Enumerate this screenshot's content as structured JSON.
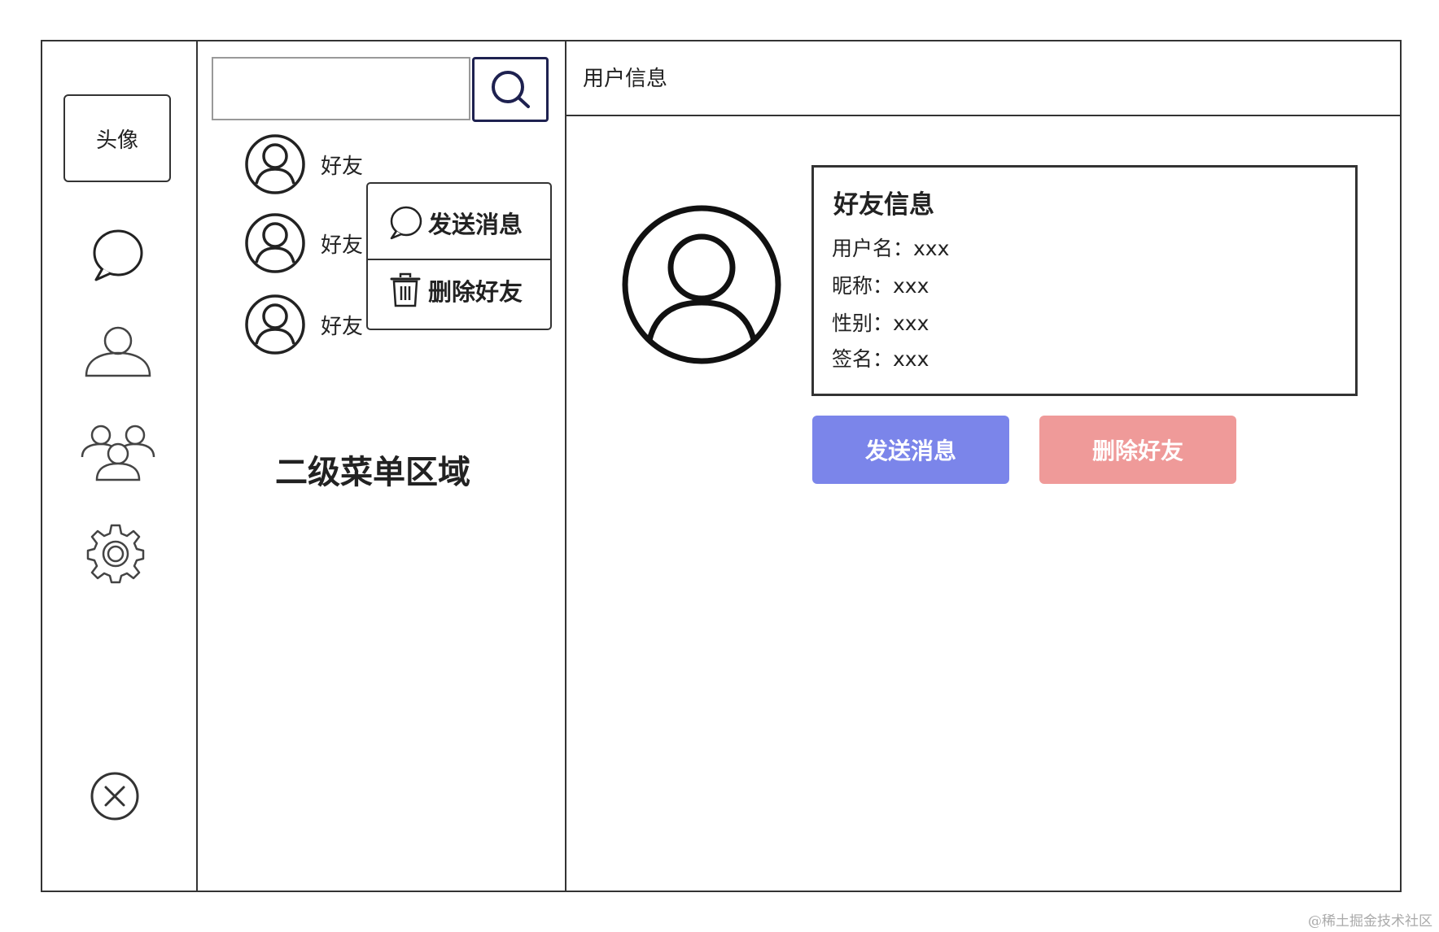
{
  "sidebar": {
    "avatar_label": "头像",
    "icons": [
      "chat-icon",
      "user-icon",
      "group-icon",
      "settings-icon",
      "close-icon"
    ]
  },
  "search": {
    "value": "",
    "placeholder": ""
  },
  "friends": [
    {
      "name": "好友"
    },
    {
      "name": "好友"
    },
    {
      "name": "好友"
    }
  ],
  "context_menu": {
    "send_label": "发送消息",
    "delete_label": "删除好友"
  },
  "secondary_menu_label": "二级菜单区域",
  "header": {
    "title": "用户信息"
  },
  "friend_info": {
    "title": "好友信息",
    "username": "用户名：xxx",
    "nickname": "昵称：xxx",
    "gender": "性别：xxx",
    "signature": "签名：xxx"
  },
  "actions": {
    "send_label": "发送消息",
    "delete_label": "删除好友",
    "send_color": "#7b85ea",
    "delete_color": "#ef9a99"
  },
  "watermark": "@稀土掘金技术社区"
}
